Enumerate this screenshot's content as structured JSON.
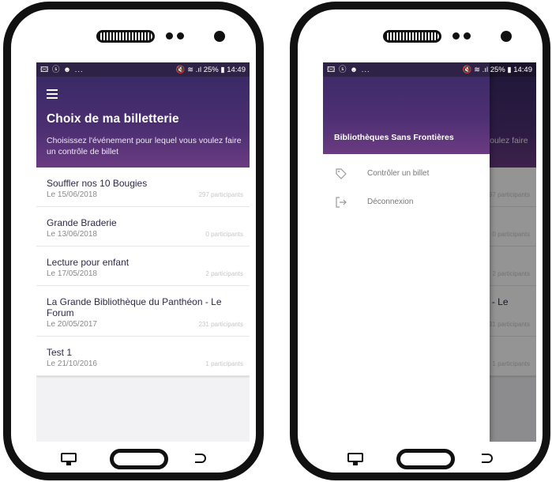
{
  "status": {
    "left_icons": "🖾 ⓢ ☻ ...",
    "right_text": "🔇 ≋ .ıl 25% ▮ 14:49"
  },
  "header": {
    "title": "Choix de ma billetterie",
    "subtitle": "Choisissez l'événement pour lequel vous voulez faire un contrôle de billet"
  },
  "events": [
    {
      "title": "Souffler nos 10 Bougies",
      "date": "Le 15/06/2018",
      "count": "297 participants"
    },
    {
      "title": "Grande Braderie",
      "date": "Le 13/06/2018",
      "count": "0 participants"
    },
    {
      "title": "Lecture pour enfant",
      "date": "Le 17/05/2018",
      "count": "2 participants"
    },
    {
      "title": "La Grande Bibliothèque du Panthéon - Le Forum",
      "date": "Le 20/05/2017",
      "count": "231 participants"
    },
    {
      "title": "Test 1",
      "date": "Le 21/10/2016",
      "count": "1 participants"
    }
  ],
  "drawer": {
    "organization": "Bibliothèques Sans Frontières",
    "items": [
      {
        "label": "Contrôler un billet",
        "icon": "tag-icon"
      },
      {
        "label": "Déconnexion",
        "icon": "logout-icon"
      }
    ]
  },
  "colors": {
    "header_top": "#3a2a66",
    "header_bottom": "#6b3b82",
    "status_bar": "#2f2247"
  }
}
